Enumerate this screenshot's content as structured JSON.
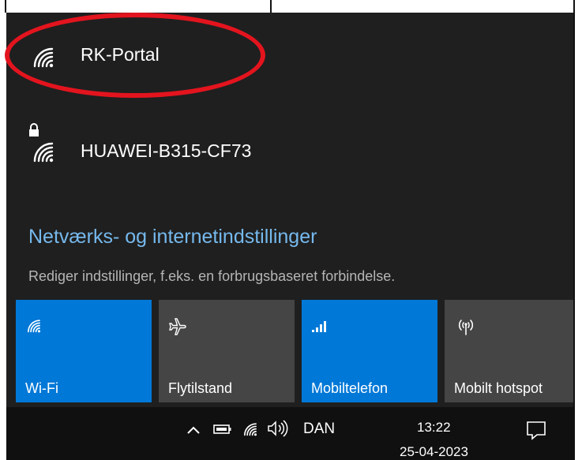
{
  "networks": [
    {
      "name": "RK-Portal",
      "secured": false,
      "icon": "wifi-signal-icon"
    },
    {
      "name": "HUAWEI-B315-CF73",
      "secured": true,
      "icon": "wifi-secured-icon"
    }
  ],
  "settings": {
    "link": "Netværks- og internetindstillinger",
    "description": "Rediger indstillinger, f.eks. en forbrugsbaseret forbindelse."
  },
  "quick_actions": [
    {
      "label": "Wi-Fi",
      "icon": "wifi-icon",
      "active": true
    },
    {
      "label": "Flytilstand",
      "icon": "airplane-icon",
      "active": false
    },
    {
      "label": "Mobiltelefon",
      "icon": "cellular-signal-icon",
      "active": true
    },
    {
      "label": "Mobilt hotspot",
      "icon": "hotspot-icon",
      "active": false
    }
  ],
  "taskbar": {
    "language": "DAN",
    "time": "13:22",
    "date": "25-04-2023"
  },
  "colors": {
    "flyout_bg": "#1f1f1f",
    "accent": "#0078d7",
    "link": "#76b9ed",
    "highlight": "#e3141e"
  }
}
